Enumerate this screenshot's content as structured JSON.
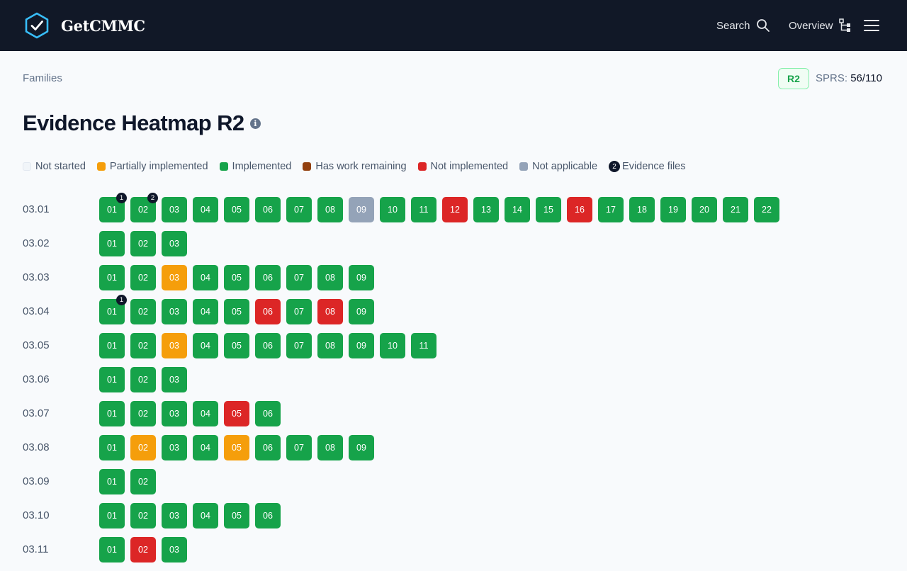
{
  "app": {
    "name": "GetCMMC"
  },
  "nav": {
    "search_label": "Search",
    "overview_label": "Overview"
  },
  "breadcrumb": "Families",
  "level_badge": "R2",
  "sprs": {
    "label": "SPRS:",
    "value": "56/110"
  },
  "page_title": "Evidence Heatmap R2",
  "colors": {
    "implemented": "#16a34a",
    "partial": "#f59e0b",
    "not_implemented": "#dc2626",
    "not_applicable": "#94a3b8",
    "work_remaining": "#92400e",
    "not_started": "#f1f5f9"
  },
  "legend": [
    {
      "label": "Not started",
      "status": "not_started"
    },
    {
      "label": "Partially implemented",
      "status": "partial"
    },
    {
      "label": "Implemented",
      "status": "implemented"
    },
    {
      "label": "Has work remaining",
      "status": "work_remaining"
    },
    {
      "label": "Not implemented",
      "status": "not_implemented"
    },
    {
      "label": "Not applicable",
      "status": "not_applicable"
    },
    {
      "label": "Evidence files",
      "status": "evidence",
      "count": "2"
    }
  ],
  "families": [
    {
      "id": "03.01",
      "controls": [
        {
          "label": "01",
          "status": "implemented",
          "evidence": "1"
        },
        {
          "label": "02",
          "status": "implemented",
          "evidence": "2"
        },
        {
          "label": "03",
          "status": "implemented"
        },
        {
          "label": "04",
          "status": "implemented"
        },
        {
          "label": "05",
          "status": "implemented"
        },
        {
          "label": "06",
          "status": "implemented"
        },
        {
          "label": "07",
          "status": "implemented"
        },
        {
          "label": "08",
          "status": "implemented"
        },
        {
          "label": "09",
          "status": "not_applicable"
        },
        {
          "label": "10",
          "status": "implemented"
        },
        {
          "label": "11",
          "status": "implemented"
        },
        {
          "label": "12",
          "status": "not_implemented"
        },
        {
          "label": "13",
          "status": "implemented"
        },
        {
          "label": "14",
          "status": "implemented"
        },
        {
          "label": "15",
          "status": "implemented"
        },
        {
          "label": "16",
          "status": "not_implemented"
        },
        {
          "label": "17",
          "status": "implemented"
        },
        {
          "label": "18",
          "status": "implemented"
        },
        {
          "label": "19",
          "status": "implemented"
        },
        {
          "label": "20",
          "status": "implemented"
        },
        {
          "label": "21",
          "status": "implemented"
        },
        {
          "label": "22",
          "status": "implemented"
        }
      ]
    },
    {
      "id": "03.02",
      "controls": [
        {
          "label": "01",
          "status": "implemented"
        },
        {
          "label": "02",
          "status": "implemented"
        },
        {
          "label": "03",
          "status": "implemented"
        }
      ]
    },
    {
      "id": "03.03",
      "controls": [
        {
          "label": "01",
          "status": "implemented"
        },
        {
          "label": "02",
          "status": "implemented"
        },
        {
          "label": "03",
          "status": "partial"
        },
        {
          "label": "04",
          "status": "implemented"
        },
        {
          "label": "05",
          "status": "implemented"
        },
        {
          "label": "06",
          "status": "implemented"
        },
        {
          "label": "07",
          "status": "implemented"
        },
        {
          "label": "08",
          "status": "implemented"
        },
        {
          "label": "09",
          "status": "implemented"
        }
      ]
    },
    {
      "id": "03.04",
      "controls": [
        {
          "label": "01",
          "status": "implemented",
          "evidence": "1"
        },
        {
          "label": "02",
          "status": "implemented"
        },
        {
          "label": "03",
          "status": "implemented"
        },
        {
          "label": "04",
          "status": "implemented"
        },
        {
          "label": "05",
          "status": "implemented"
        },
        {
          "label": "06",
          "status": "not_implemented"
        },
        {
          "label": "07",
          "status": "implemented"
        },
        {
          "label": "08",
          "status": "not_implemented"
        },
        {
          "label": "09",
          "status": "implemented"
        }
      ]
    },
    {
      "id": "03.05",
      "controls": [
        {
          "label": "01",
          "status": "implemented"
        },
        {
          "label": "02",
          "status": "implemented"
        },
        {
          "label": "03",
          "status": "partial"
        },
        {
          "label": "04",
          "status": "implemented"
        },
        {
          "label": "05",
          "status": "implemented"
        },
        {
          "label": "06",
          "status": "implemented"
        },
        {
          "label": "07",
          "status": "implemented"
        },
        {
          "label": "08",
          "status": "implemented"
        },
        {
          "label": "09",
          "status": "implemented"
        },
        {
          "label": "10",
          "status": "implemented"
        },
        {
          "label": "11",
          "status": "implemented"
        }
      ]
    },
    {
      "id": "03.06",
      "controls": [
        {
          "label": "01",
          "status": "implemented"
        },
        {
          "label": "02",
          "status": "implemented"
        },
        {
          "label": "03",
          "status": "implemented"
        }
      ]
    },
    {
      "id": "03.07",
      "controls": [
        {
          "label": "01",
          "status": "implemented"
        },
        {
          "label": "02",
          "status": "implemented"
        },
        {
          "label": "03",
          "status": "implemented"
        },
        {
          "label": "04",
          "status": "implemented"
        },
        {
          "label": "05",
          "status": "not_implemented"
        },
        {
          "label": "06",
          "status": "implemented"
        }
      ]
    },
    {
      "id": "03.08",
      "controls": [
        {
          "label": "01",
          "status": "implemented"
        },
        {
          "label": "02",
          "status": "partial"
        },
        {
          "label": "03",
          "status": "implemented"
        },
        {
          "label": "04",
          "status": "implemented"
        },
        {
          "label": "05",
          "status": "partial"
        },
        {
          "label": "06",
          "status": "implemented"
        },
        {
          "label": "07",
          "status": "implemented"
        },
        {
          "label": "08",
          "status": "implemented"
        },
        {
          "label": "09",
          "status": "implemented"
        }
      ]
    },
    {
      "id": "03.09",
      "controls": [
        {
          "label": "01",
          "status": "implemented"
        },
        {
          "label": "02",
          "status": "implemented"
        }
      ]
    },
    {
      "id": "03.10",
      "controls": [
        {
          "label": "01",
          "status": "implemented"
        },
        {
          "label": "02",
          "status": "implemented"
        },
        {
          "label": "03",
          "status": "implemented"
        },
        {
          "label": "04",
          "status": "implemented"
        },
        {
          "label": "05",
          "status": "implemented"
        },
        {
          "label": "06",
          "status": "implemented"
        }
      ]
    },
    {
      "id": "03.11",
      "controls": [
        {
          "label": "01",
          "status": "implemented"
        },
        {
          "label": "02",
          "status": "not_implemented"
        },
        {
          "label": "03",
          "status": "implemented"
        }
      ]
    }
  ]
}
